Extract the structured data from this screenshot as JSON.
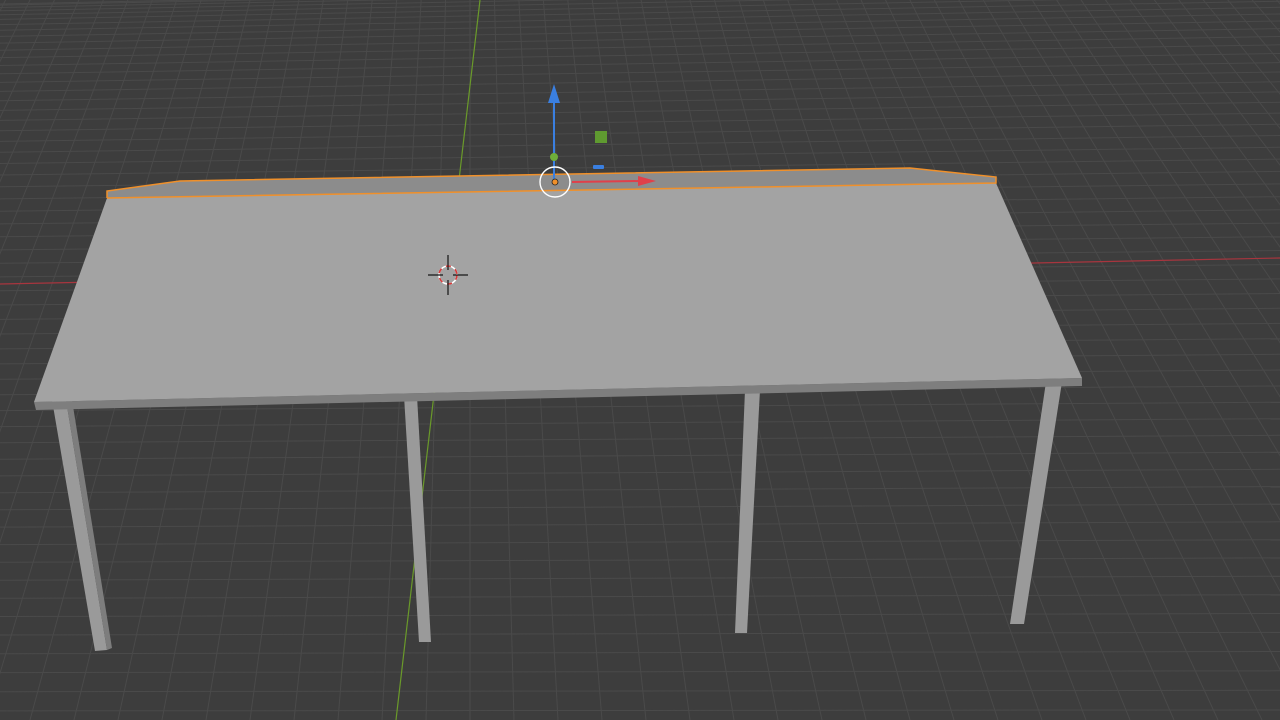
{
  "viewport": {
    "mode": "3D Viewport",
    "background_color": "#3d3d3d",
    "grid_color": "#4a4a4a",
    "x_axis_color": "#a8353e",
    "y_axis_color": "#6a9a2a"
  },
  "scene_object": {
    "type": "table",
    "top_color": "#a3a3a3",
    "edge_color": "#8c8c8c",
    "leg_color": "#9a9a9a",
    "selected_part": "top-back-edge",
    "selection_outline_color": "#f0902a",
    "leg_count": 4
  },
  "gizmo": {
    "z_arrow_color": "#3a7fe0",
    "x_arrow_color": "#e0404a",
    "y_handle_color": "#6fae3a",
    "plane_handle_color": "#5f9a30"
  },
  "cursor_3d": {
    "icon": "3d-cursor-icon"
  }
}
